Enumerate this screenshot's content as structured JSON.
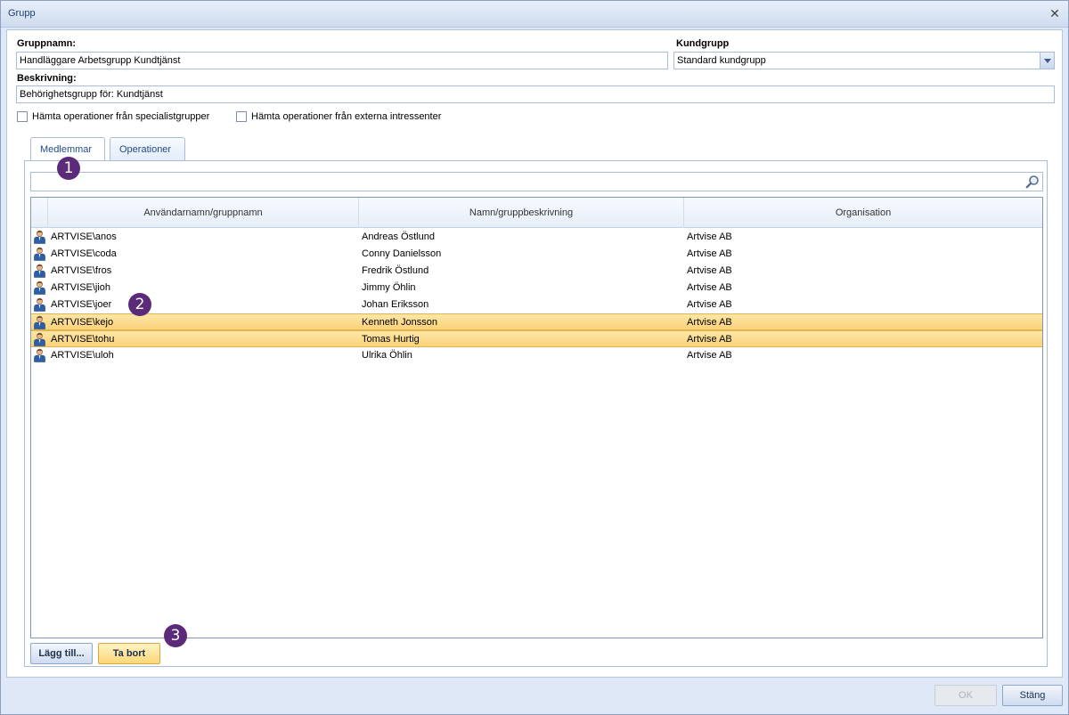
{
  "window": {
    "title": "Grupp"
  },
  "form": {
    "gruppnamn_label": "Gruppnamn:",
    "gruppnamn_value": "Handläggare Arbetsgrupp Kundtjänst",
    "kundgrupp_label": "Kundgrupp",
    "kundgrupp_value": "Standard kundgrupp",
    "beskrivning_label": "Beskrivning:",
    "beskrivning_value": "Behörighetsgrupp för: Kundtjänst",
    "check_specialist": "Hämta operationer från specialistgrupper",
    "check_externa": "Hämta operationer från externa intressenter"
  },
  "tabs": [
    "Medlemmar",
    "Operationer"
  ],
  "grid": {
    "columns": [
      "Användarnamn/gruppnamn",
      "Namn/gruppbeskrivning",
      "Organisation"
    ],
    "rows": [
      {
        "user": "ARTVISE\\anos",
        "name": "Andreas Östlund",
        "org": "Artvise AB"
      },
      {
        "user": "ARTVISE\\coda",
        "name": "Conny Danielsson",
        "org": "Artvise AB"
      },
      {
        "user": "ARTVISE\\fros",
        "name": "Fredrik Östlund",
        "org": "Artvise AB"
      },
      {
        "user": "ARTVISE\\jioh",
        "name": "Jimmy Öhlin",
        "org": "Artvise AB"
      },
      {
        "user": "ARTVISE\\joer",
        "name": "Johan Eriksson",
        "org": "Artvise AB"
      },
      {
        "user": "ARTVISE\\kejo",
        "name": "Kenneth Jonsson",
        "org": "Artvise AB"
      },
      {
        "user": "ARTVISE\\tohu",
        "name": "Tomas Hurtig",
        "org": "Artvise AB"
      },
      {
        "user": "ARTVISE\\uloh",
        "name": "Ulrika Öhlin",
        "org": "Artvise AB"
      }
    ]
  },
  "callouts": [
    "1",
    "2",
    "3"
  ],
  "buttons": {
    "add": "Lägg till...",
    "remove": "Ta bort",
    "ok": "OK",
    "close": "Stäng"
  }
}
